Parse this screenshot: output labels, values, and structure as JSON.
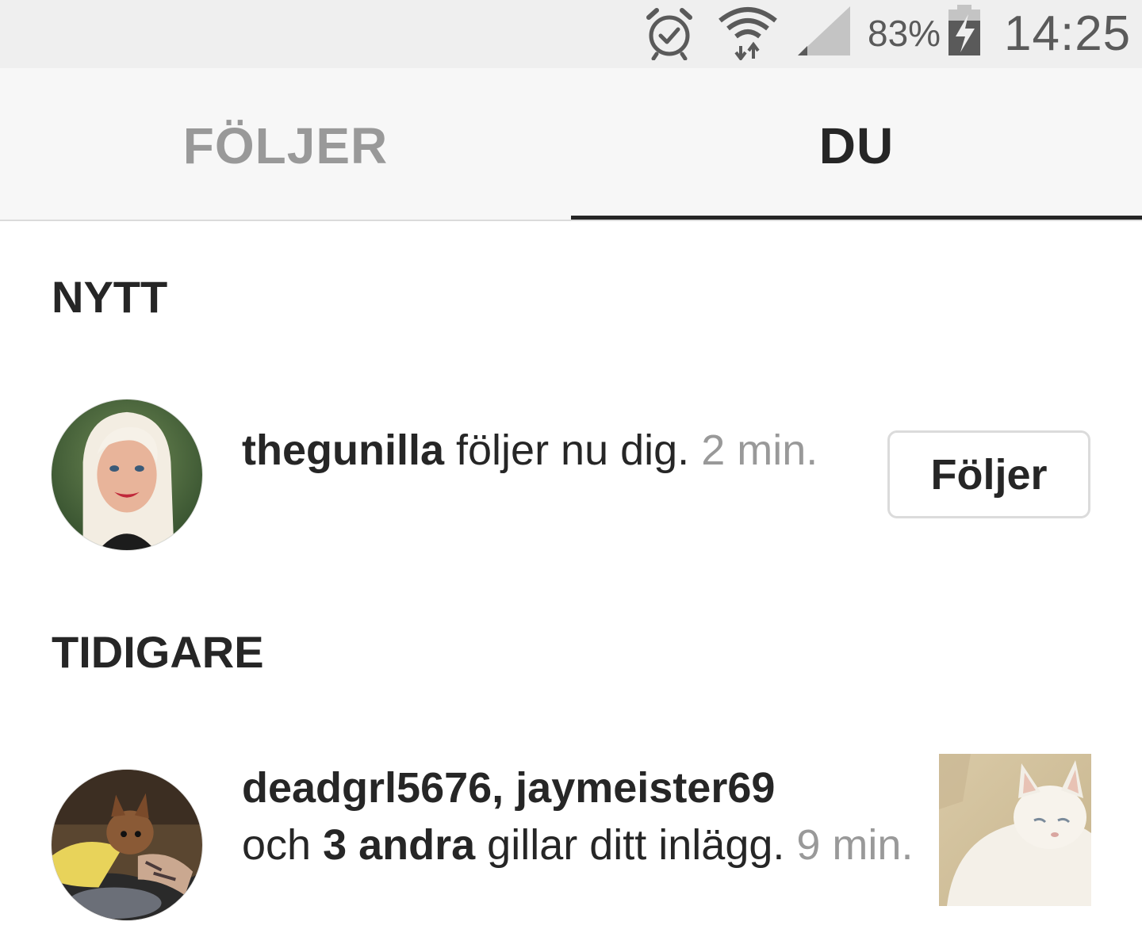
{
  "status_bar": {
    "icons": [
      "alarm-icon",
      "wifi-icon",
      "signal-icon",
      "battery-charging-icon"
    ],
    "battery_percent": "83%",
    "time": "14:25"
  },
  "tabs": [
    {
      "label": "FÖLJER",
      "active": false
    },
    {
      "label": "DU",
      "active": true
    }
  ],
  "sections": {
    "new": {
      "heading": "NYTT",
      "items": [
        {
          "username": "thegunilla",
          "action": " följer nu dig. ",
          "time": "2 min.",
          "button_label": "Följer"
        }
      ]
    },
    "earlier": {
      "heading": "TIDIGARE",
      "items": [
        {
          "usernames": "deadgrl5676, jaymeister69",
          "connector": "och ",
          "others": "3 andra",
          "action": " gillar ditt inlägg. ",
          "time": "9 min."
        }
      ]
    }
  },
  "colors": {
    "primary_text": "#262626",
    "muted_text": "#999999",
    "border": "#dbdbdb",
    "status_bar_bg": "#efefef",
    "tab_bar_bg": "#f7f7f7"
  }
}
